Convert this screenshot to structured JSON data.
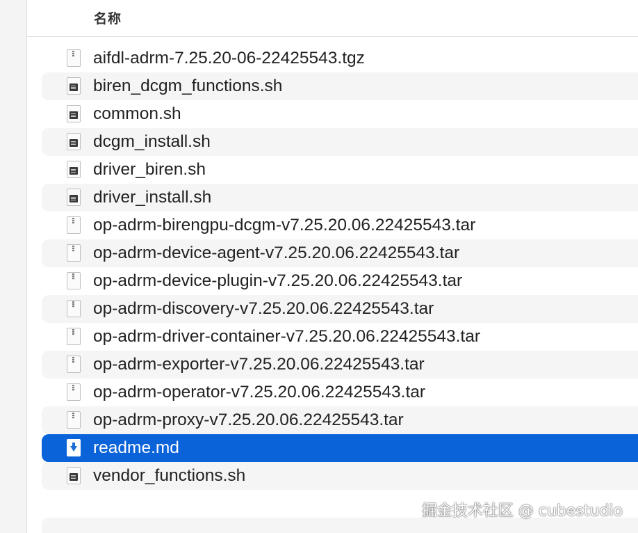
{
  "header": {
    "name_column": "名称"
  },
  "files": [
    {
      "name": "aifdl-adrm-7.25.20-06-22425543.tgz",
      "icon": "archive-icon",
      "selected": false
    },
    {
      "name": "biren_dcgm_functions.sh",
      "icon": "script-icon",
      "selected": false
    },
    {
      "name": "common.sh",
      "icon": "script-icon",
      "selected": false
    },
    {
      "name": "dcgm_install.sh",
      "icon": "script-icon",
      "selected": false
    },
    {
      "name": "driver_biren.sh",
      "icon": "script-icon",
      "selected": false
    },
    {
      "name": "driver_install.sh",
      "icon": "script-icon",
      "selected": false
    },
    {
      "name": "op-adrm-birengpu-dcgm-v7.25.20.06.22425543.tar",
      "icon": "archive-icon",
      "selected": false
    },
    {
      "name": "op-adrm-device-agent-v7.25.20.06.22425543.tar",
      "icon": "archive-icon",
      "selected": false
    },
    {
      "name": "op-adrm-device-plugin-v7.25.20.06.22425543.tar",
      "icon": "archive-icon",
      "selected": false
    },
    {
      "name": "op-adrm-discovery-v7.25.20.06.22425543.tar",
      "icon": "archive-icon",
      "selected": false
    },
    {
      "name": "op-adrm-driver-container-v7.25.20.06.22425543.tar",
      "icon": "archive-icon",
      "selected": false
    },
    {
      "name": "op-adrm-exporter-v7.25.20.06.22425543.tar",
      "icon": "archive-icon",
      "selected": false
    },
    {
      "name": "op-adrm-operator-v7.25.20.06.22425543.tar",
      "icon": "archive-icon",
      "selected": false
    },
    {
      "name": "op-adrm-proxy-v7.25.20.06.22425543.tar",
      "icon": "archive-icon",
      "selected": false
    },
    {
      "name": "readme.md",
      "icon": "markdown-icon",
      "selected": true
    },
    {
      "name": "vendor_functions.sh",
      "icon": "script-icon",
      "selected": false
    }
  ],
  "watermark": "掘金技术社区 @ cubestudio",
  "colors": {
    "selection": "#0a63d9",
    "alt_row": "#f5f5f5",
    "text": "#222222"
  }
}
